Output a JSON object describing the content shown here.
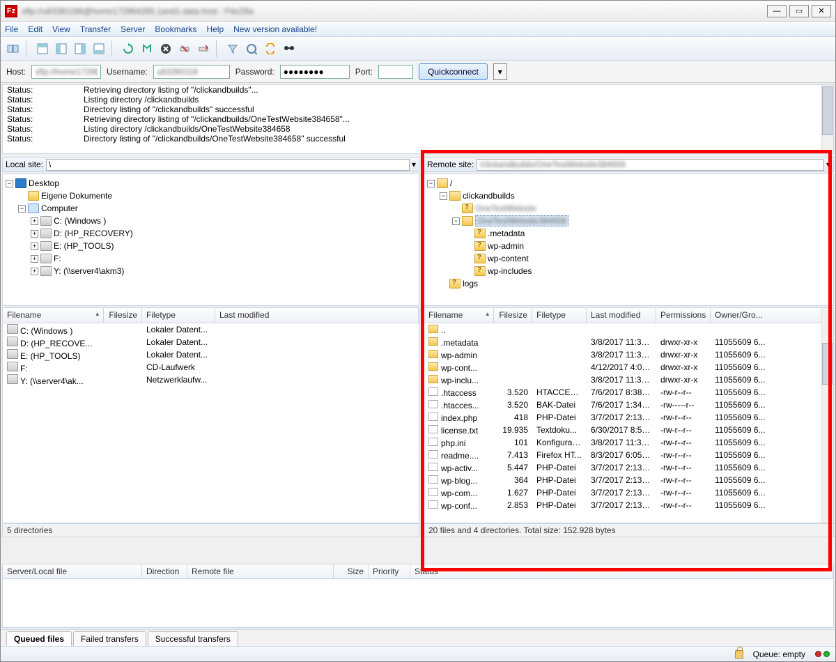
{
  "title": "sftp://u83391186@home172964285.1and1-data.host - FileZilla",
  "menu": [
    "File",
    "Edit",
    "View",
    "Transfer",
    "Server",
    "Bookmarks",
    "Help",
    "New version available!"
  ],
  "quick": {
    "host_label": "Host:",
    "host_value": "sftp://home172964",
    "user_label": "Username:",
    "user_value": "u83390118",
    "pw_label": "Password:",
    "pw_value": "●●●●●●●●",
    "port_label": "Port:",
    "port_value": "",
    "btn": "Quickconnect"
  },
  "log": [
    {
      "k": "Status:",
      "v": "Retrieving directory listing of \"/clickandbuilds\"..."
    },
    {
      "k": "Status:",
      "v": "Listing directory /clickandbuilds"
    },
    {
      "k": "Status:",
      "v": "Directory listing of \"/clickandbuilds\" successful"
    },
    {
      "k": "Status:",
      "v": "Retrieving directory listing of \"/clickandbuilds/OneTestWebsite384658\"..."
    },
    {
      "k": "Status:",
      "v": "Listing directory /clickandbuilds/OneTestWebsite384658"
    },
    {
      "k": "Status:",
      "v": "Directory listing of \"/clickandbuilds/OneTestWebsite384658\" successful"
    }
  ],
  "local_site_label": "Local site:",
  "local_site_value": "\\",
  "remote_site_label": "Remote site:",
  "remote_site_value": "/clickandbuilds/OneTestWebsite384658",
  "local_tree": [
    {
      "ind": 0,
      "exp": "−",
      "icon": "desk",
      "label": "Desktop"
    },
    {
      "ind": 1,
      "exp": "",
      "icon": "folder",
      "label": "Eigene Dokumente"
    },
    {
      "ind": 1,
      "exp": "−",
      "icon": "comp",
      "label": "Computer"
    },
    {
      "ind": 2,
      "exp": "+",
      "icon": "drive",
      "label": "C: (Windows )"
    },
    {
      "ind": 2,
      "exp": "+",
      "icon": "drive",
      "label": "D: (HP_RECOVERY)"
    },
    {
      "ind": 2,
      "exp": "+",
      "icon": "drive",
      "label": "E: (HP_TOOLS)"
    },
    {
      "ind": 2,
      "exp": "+",
      "icon": "drive",
      "label": "F:"
    },
    {
      "ind": 2,
      "exp": "+",
      "icon": "drive",
      "label": "Y: (\\\\server4\\akm3)"
    }
  ],
  "remote_tree": [
    {
      "ind": 0,
      "exp": "−",
      "icon": "folder",
      "label": "/"
    },
    {
      "ind": 1,
      "exp": "−",
      "icon": "folder",
      "label": "clickandbuilds"
    },
    {
      "ind": 2,
      "exp": "",
      "icon": "folderq",
      "label": "OneTestWebsite",
      "blur": true
    },
    {
      "ind": 2,
      "exp": "−",
      "icon": "folder",
      "label": "OneTestWebsite384658",
      "sel": true,
      "blur": true
    },
    {
      "ind": 3,
      "exp": "",
      "icon": "folderq",
      "label": ".metadata"
    },
    {
      "ind": 3,
      "exp": "",
      "icon": "folderq",
      "label": "wp-admin"
    },
    {
      "ind": 3,
      "exp": "",
      "icon": "folderq",
      "label": "wp-content"
    },
    {
      "ind": 3,
      "exp": "",
      "icon": "folderq",
      "label": "wp-includes"
    },
    {
      "ind": 1,
      "exp": "",
      "icon": "folderq",
      "label": "logs"
    }
  ],
  "local_cols": {
    "name": "Filename",
    "size": "Filesize",
    "type": "Filetype",
    "mod": "Last modified"
  },
  "local_rows": [
    {
      "icon": "drive",
      "name": "C: (Windows )",
      "size": "",
      "type": "Lokaler Datent...",
      "mod": ""
    },
    {
      "icon": "drive",
      "name": "D: (HP_RECOVE...",
      "size": "",
      "type": "Lokaler Datent...",
      "mod": ""
    },
    {
      "icon": "drive",
      "name": "E: (HP_TOOLS)",
      "size": "",
      "type": "Lokaler Datent...",
      "mod": ""
    },
    {
      "icon": "drive",
      "name": "F:",
      "size": "",
      "type": "CD-Laufwerk",
      "mod": ""
    },
    {
      "icon": "drive",
      "name": "Y: (\\\\server4\\ak...",
      "size": "",
      "type": "Netzwerklaufw...",
      "mod": ""
    }
  ],
  "local_status": "5 directories",
  "remote_cols": {
    "name": "Filename",
    "size": "Filesize",
    "type": "Filetype",
    "mod": "Last modified",
    "perm": "Permissions",
    "own": "Owner/Gro..."
  },
  "remote_rows": [
    {
      "icon": "fold",
      "name": "..",
      "size": "",
      "type": "",
      "mod": "",
      "perm": "",
      "own": ""
    },
    {
      "icon": "fold",
      "name": ".metadata",
      "size": "",
      "type": "",
      "mod": "3/8/2017 11:35:...",
      "perm": "drwxr-xr-x",
      "own": "11055609 6..."
    },
    {
      "icon": "fold",
      "name": "wp-admin",
      "size": "",
      "type": "",
      "mod": "3/8/2017 11:35:...",
      "perm": "drwxr-xr-x",
      "own": "11055609 6..."
    },
    {
      "icon": "fold",
      "name": "wp-cont...",
      "size": "",
      "type": "",
      "mod": "4/12/2017 4:01:...",
      "perm": "drwxr-xr-x",
      "own": "11055609 6..."
    },
    {
      "icon": "fold",
      "name": "wp-inclu...",
      "size": "",
      "type": "",
      "mod": "3/8/2017 11:35:...",
      "perm": "drwxr-xr-x",
      "own": "11055609 6..."
    },
    {
      "icon": "file",
      "name": ".htaccess",
      "size": "3.520",
      "type": "HTACCESS...",
      "mod": "7/6/2017 8:38:1...",
      "perm": "-rw-r--r--",
      "own": "11055609 6..."
    },
    {
      "icon": "file",
      "name": ".htacces...",
      "size": "3.520",
      "type": "BAK-Datei",
      "mod": "7/6/2017 1:34:3...",
      "perm": "-rw-----r--",
      "own": "11055609 6..."
    },
    {
      "icon": "file",
      "name": "index.php",
      "size": "418",
      "type": "PHP-Datei",
      "mod": "3/7/2017 2:13:3...",
      "perm": "-rw-r--r--",
      "own": "11055609 6..."
    },
    {
      "icon": "file",
      "name": "license.txt",
      "size": "19.935",
      "type": "Textdoku...",
      "mod": "6/30/2017 8:52:...",
      "perm": "-rw-r--r--",
      "own": "11055609 6..."
    },
    {
      "icon": "file",
      "name": "php.ini",
      "size": "101",
      "type": "Konfigurati...",
      "mod": "3/8/2017 11:35:...",
      "perm": "-rw-r--r--",
      "own": "11055609 6..."
    },
    {
      "icon": "file",
      "name": "readme....",
      "size": "7.413",
      "type": "Firefox HT...",
      "mod": "8/3/2017 6:05:2...",
      "perm": "-rw-r--r--",
      "own": "11055609 6..."
    },
    {
      "icon": "file",
      "name": "wp-activ...",
      "size": "5.447",
      "type": "PHP-Datei",
      "mod": "3/7/2017 2:13:3...",
      "perm": "-rw-r--r--",
      "own": "11055609 6..."
    },
    {
      "icon": "file",
      "name": "wp-blog...",
      "size": "364",
      "type": "PHP-Datei",
      "mod": "3/7/2017 2:13:3...",
      "perm": "-rw-r--r--",
      "own": "11055609 6..."
    },
    {
      "icon": "file",
      "name": "wp-com...",
      "size": "1.627",
      "type": "PHP-Datei",
      "mod": "3/7/2017 2:13:3...",
      "perm": "-rw-r--r--",
      "own": "11055609 6..."
    },
    {
      "icon": "file",
      "name": "wp-conf...",
      "size": "2.853",
      "type": "PHP-Datei",
      "mod": "3/7/2017 2:13:3...",
      "perm": "-rw-r--r--",
      "own": "11055609 6..."
    }
  ],
  "remote_status": "20 files and 4 directories. Total size: 152.928 bytes",
  "queue_cols": [
    "Server/Local file",
    "Direction",
    "Remote file",
    "Size",
    "Priority",
    "Status"
  ],
  "bottom_tabs": [
    "Queued files",
    "Failed transfers",
    "Successful transfers"
  ],
  "footer_queue": "Queue: empty"
}
